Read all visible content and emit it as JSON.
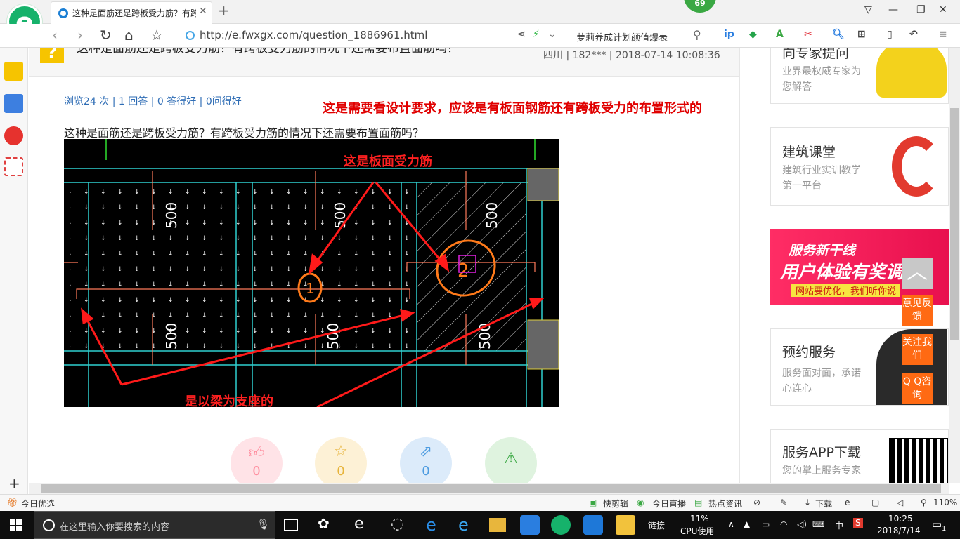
{
  "browser": {
    "tab_title": "这种是面筋还是跨板受力筋？有跨板受力筋",
    "badge": "69",
    "url": "http://e.fwxgx.com/question_1886961.html",
    "search_text": "萝莉养成计划颜值爆表"
  },
  "question": {
    "title": "这种是面筋还是跨板受力筋？有跨板受力筋的情况下还需要布置面筋吗？",
    "meta": "四川 | 182*** | 2018-07-14 10:08:36",
    "stats": "浏览24 次 | 1 回答 | 0 答得好 | 0问得好",
    "best_answer": "这是需要看设计要求，应该是有板面钢筋还有跨板受力的布置形式的",
    "body": "这种是面筋还是跨板受力筋？有跨板受力筋的情况下还需要布置面筋吗？"
  },
  "drawing": {
    "annotation_top": "这是板面受力筋",
    "annotation_bottom": "是以梁为支座的",
    "dim_label": "500",
    "circle_1": "1",
    "circle_2": "2"
  },
  "actions": [
    {
      "name": "like",
      "count": "0",
      "color": "#ff8fa0",
      "bg": "#ffe3e7"
    },
    {
      "name": "favorite",
      "count": "0",
      "color": "#e7b43b",
      "bg": "#fdf1d6"
    },
    {
      "name": "share",
      "count": "0",
      "color": "#4c9be0",
      "bg": "#dcebfa"
    },
    {
      "name": "report",
      "count": "",
      "color": "#3aa843",
      "bg": "#dff3df"
    }
  ],
  "sidebar_right": {
    "expert": {
      "title": "向专家提问",
      "sub": "业界最权威专家为您解答"
    },
    "course": {
      "title": "建筑课堂",
      "sub": "建筑行业实训教学第一平台"
    },
    "banner": {
      "line1": "服务新干线",
      "line2": "用户体验有奖调研",
      "line3": "网站要优化，我们听你说"
    },
    "booking": {
      "title": "预约服务",
      "sub": "服务面对面，承诺心连心"
    },
    "app": {
      "title": "服务APP下载",
      "sub": "您的掌上服务专家"
    },
    "float": {
      "feedback": "意见反馈",
      "follow": "关注我们",
      "qq": "Q Q咨询"
    }
  },
  "statusbar": {
    "left": "今日优选",
    "kuaijian": "快剪辑",
    "live": "今日直播",
    "news": "热点资讯",
    "download": "下载",
    "zoom": "110%"
  },
  "taskbar": {
    "search_placeholder": "在这里输入你要搜索的内容",
    "links": "链接",
    "cpu_percent": "11%",
    "cpu_label": "CPU使用",
    "ime": "中",
    "time": "10:25",
    "date": "2018/7/14",
    "notification_count": "1"
  }
}
